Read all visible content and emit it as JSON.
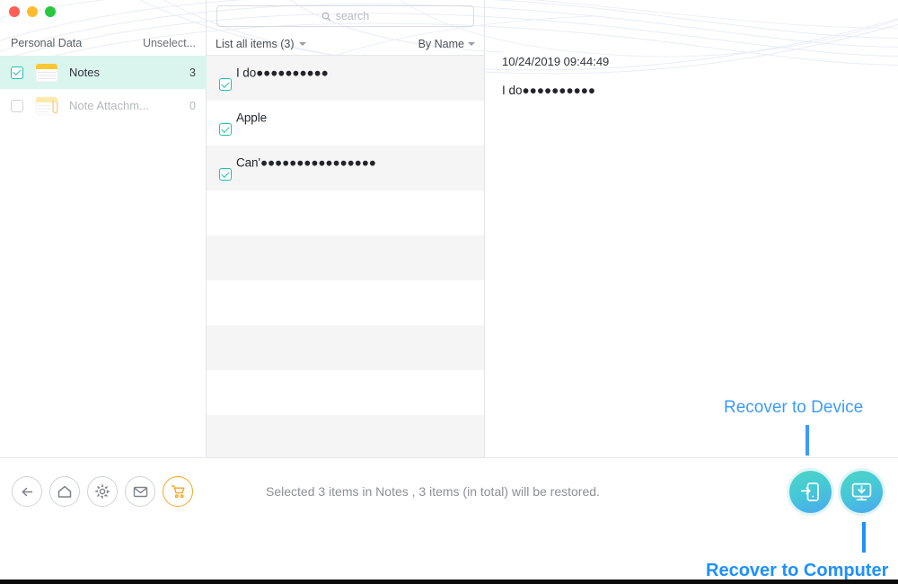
{
  "window": {
    "controls": [
      "close",
      "minimize",
      "zoom"
    ]
  },
  "sidebar": {
    "title": "Personal Data",
    "action_label": "Unselect...",
    "items": [
      {
        "label": "Notes",
        "count": "3",
        "checked": true,
        "disabled": false,
        "icon": "notepad-icon"
      },
      {
        "label": "Note Attachm...",
        "count": "0",
        "checked": false,
        "disabled": true,
        "icon": "note-attachment-icon"
      }
    ]
  },
  "list_pane": {
    "search": {
      "placeholder": "search",
      "value": "",
      "icon": "search-icon"
    },
    "filter_label": "List all items (3)",
    "sort_label": "By Name",
    "items": [
      {
        "text": "I do●●●●●●●●●●",
        "checked": true
      },
      {
        "text": "Apple",
        "checked": true
      },
      {
        "text": "Can'●●●●●●●●●●●●●●●●",
        "checked": true
      }
    ],
    "empty_row_count": 6
  },
  "detail": {
    "date": "10/24/2019 09:44:49",
    "body": "I do●●●●●●●●●●"
  },
  "toolbar": {
    "icons": [
      {
        "name": "back-arrow-icon",
        "label": "Back"
      },
      {
        "name": "home-icon",
        "label": "Home"
      },
      {
        "name": "gear-icon",
        "label": "Settings"
      },
      {
        "name": "mail-icon",
        "label": "Mail"
      },
      {
        "name": "cart-icon",
        "label": "Store"
      }
    ],
    "status": "Selected 3 items in Notes , 3 items (in total) will be restored.",
    "recover_device": {
      "name": "recover-to-device-button",
      "icon": "device-export-icon"
    },
    "recover_computer": {
      "name": "recover-to-computer-button",
      "icon": "monitor-download-icon"
    }
  },
  "annotations": {
    "device_label": "Recover to Device",
    "computer_label": "Recover to Computer"
  },
  "colors": {
    "accent_teal": "#21c1ad",
    "selected_row": "#d9f5ee",
    "annotation_blue": "#3d9bf7",
    "cart_orange": "#f5a623"
  }
}
